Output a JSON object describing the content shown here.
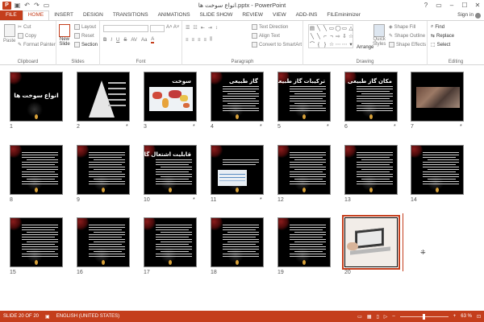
{
  "window": {
    "title": "انواع سوخت ها.pptx - PowerPoint",
    "app_logo": "P",
    "controls": [
      "?",
      "▭",
      "–",
      "☐",
      "✕"
    ]
  },
  "qat": [
    "save-icon",
    "undo-icon",
    "redo-icon",
    "start-from-beginning-icon"
  ],
  "tabs": [
    "FILE",
    "HOME",
    "INSERT",
    "DESIGN",
    "TRANSITIONS",
    "ANIMATIONS",
    "SLIDE SHOW",
    "REVIEW",
    "VIEW",
    "ADD-INS",
    "FILEminimizer"
  ],
  "active_tab": "HOME",
  "signin_label": "Sign in",
  "ribbon": {
    "clipboard": {
      "label": "Clipboard",
      "paste": "Paste",
      "cut": "Cut",
      "copy": "Copy",
      "format_painter": "Format Painter"
    },
    "slides": {
      "label": "Slides",
      "new_slide": "New",
      "new_slide_2": "Slide",
      "layout": "Layout",
      "reset": "Reset",
      "section": "Section"
    },
    "font": {
      "label": "Font"
    },
    "paragraph": {
      "label": "Paragraph",
      "text_direction": "Text Direction",
      "align_text": "Align Text",
      "convert_smartart": "Convert to SmartArt"
    },
    "drawing": {
      "label": "Drawing",
      "arrange": "Arrange",
      "quick_styles": "Quick",
      "quick_styles_2": "Styles",
      "shape_fill": "Shape Fill",
      "shape_outline": "Shape Outline",
      "shape_effects": "Shape Effects"
    },
    "editing": {
      "label": "Editing",
      "find": "Find",
      "replace": "Replace",
      "select": "Select"
    }
  },
  "slides": [
    {
      "num": "1",
      "star": "",
      "kind": "title",
      "title": "انواع سوخت ها"
    },
    {
      "num": "2",
      "star": "*",
      "kind": "pyramid",
      "title": ""
    },
    {
      "num": "3",
      "star": "*",
      "kind": "map",
      "title": "سوخت"
    },
    {
      "num": "4",
      "star": "*",
      "kind": "text",
      "title": "گاز طبیعی"
    },
    {
      "num": "5",
      "star": "*",
      "kind": "text",
      "title": "ترکیبات گاز طبیعی"
    },
    {
      "num": "6",
      "star": "*",
      "kind": "text",
      "title": "مکان گاز طبیعی"
    },
    {
      "num": "7",
      "star": "*",
      "kind": "photo",
      "title": ""
    },
    {
      "num": "8",
      "star": "",
      "kind": "dense",
      "title": ""
    },
    {
      "num": "9",
      "star": "",
      "kind": "dense",
      "title": ""
    },
    {
      "num": "10",
      "star": "*",
      "kind": "text",
      "title": "قابلیت اشتعال گاز طبیعی"
    },
    {
      "num": "11",
      "star": "*",
      "kind": "chart",
      "title": ""
    },
    {
      "num": "12",
      "star": "",
      "kind": "dense",
      "title": ""
    },
    {
      "num": "13",
      "star": "",
      "kind": "dense",
      "title": ""
    },
    {
      "num": "14",
      "star": "",
      "kind": "dense",
      "title": ""
    },
    {
      "num": "15",
      "star": "",
      "kind": "dense",
      "title": ""
    },
    {
      "num": "16",
      "star": "",
      "kind": "dense",
      "title": ""
    },
    {
      "num": "17",
      "star": "",
      "kind": "dense",
      "title": ""
    },
    {
      "num": "18",
      "star": "",
      "kind": "dense",
      "title": ""
    },
    {
      "num": "19",
      "star": "",
      "kind": "dense",
      "title": ""
    },
    {
      "num": "20",
      "star": "",
      "kind": "laptop",
      "title": ""
    }
  ],
  "selected_slide": "20",
  "status": {
    "slide_counter": "SLIDE 20 OF 20",
    "language": "ENGLISH (UNITED STATES)",
    "zoom": "63 %",
    "zoom_fraction": 0.63
  },
  "colors": {
    "accent": "#c43e1c",
    "slide_bg": "#000000"
  }
}
